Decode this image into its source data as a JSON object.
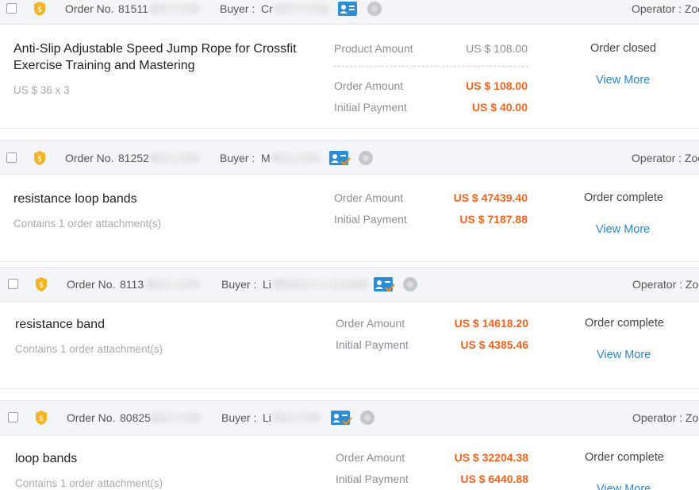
{
  "labels": {
    "order_no": "Order No.",
    "buyer": "Buyer :",
    "operator": "Operator : Zoe",
    "product_amount": "Product Amount",
    "order_amount": "Order Amount",
    "initial_payment": "Initial Payment",
    "view_more": "View More"
  },
  "orders": [
    {
      "order_no_partial": "81511",
      "buyer_partial": "Cr",
      "title": "Anti-Slip Adjustable Speed Jump Rope for Crossfit Exercise Training and Mastering",
      "subtitle": "US $ 36 x 3",
      "product_amount": "US $ 108.00",
      "order_amount": "US $ 108.00",
      "initial_payment": "US $ 40.00",
      "status": "Order closed"
    },
    {
      "order_no_partial": "81252",
      "buyer_partial": "M",
      "title": "resistance loop bands",
      "subtitle": "Contains 1 order attachment(s)",
      "order_amount": "US $ 47439.40",
      "initial_payment": "US $ 7187.88",
      "status": "Order complete"
    },
    {
      "order_no_partial": "8113",
      "buyer_partial": "Li",
      "title": "resistance band",
      "subtitle": "Contains 1 order attachment(s)",
      "order_amount": "US $ 14618.20",
      "initial_payment": "US $ 4385.46",
      "status": "Order complete"
    },
    {
      "order_no_partial": "80825",
      "buyer_partial": "Li",
      "title": "loop bands",
      "subtitle": "Contains 1 order attachment(s)",
      "order_amount": "US $ 32204.38",
      "initial_payment": "US $ 6440.88",
      "status": "Order complete"
    }
  ],
  "colors": {
    "accent_orange": "#f0641e",
    "link_blue": "#2e86c9",
    "badge_yellow": "#f5b324",
    "contact_blue": "#2d8cd6"
  }
}
